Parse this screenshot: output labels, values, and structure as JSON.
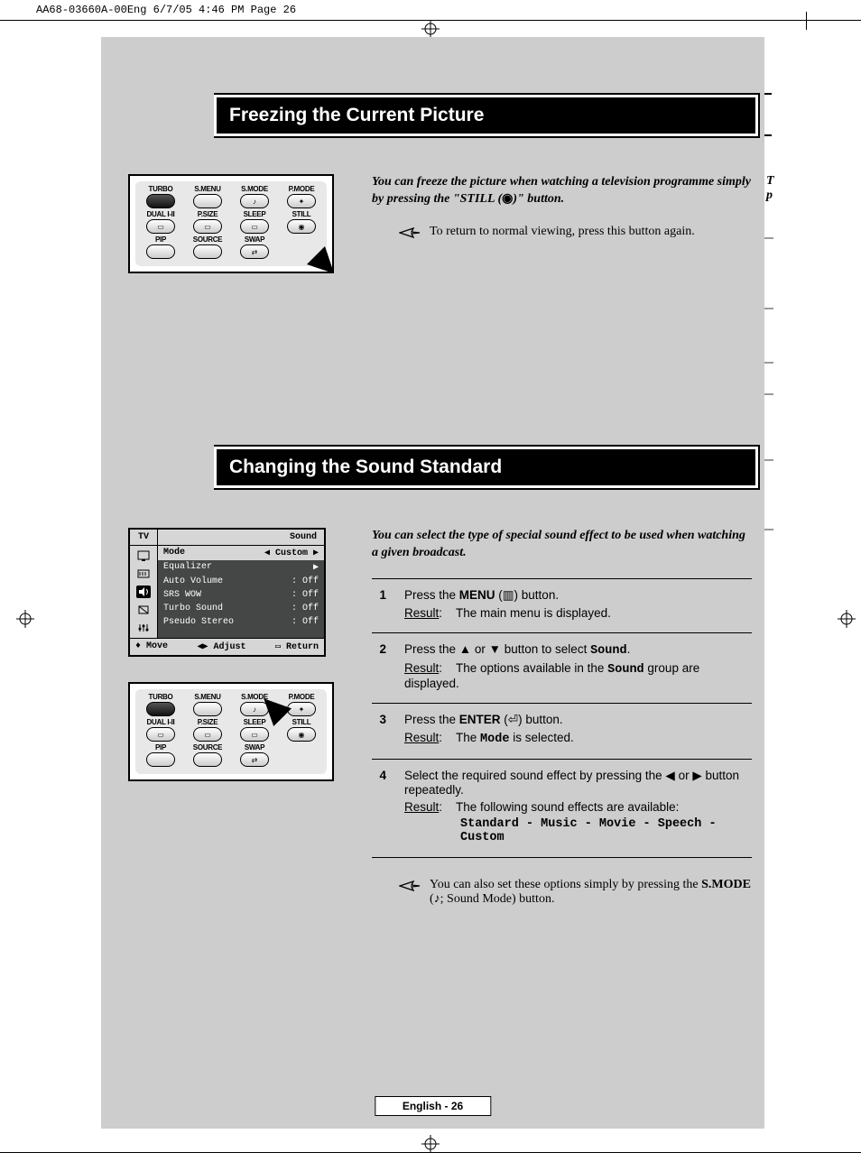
{
  "header": "AA68-03660A-00Eng  6/7/05  4:46 PM  Page 26",
  "section1": {
    "title": "Freezing the Current Picture",
    "intro_a": "You can freeze the picture when watching a television programme simply by pressing the \"STILL (",
    "intro_b": ")\" button.",
    "note": "To return to normal viewing, press this button again."
  },
  "section2": {
    "title": "Changing the Sound Standard",
    "intro": "You can select the type of special sound effect to be used when watching a given broadcast.",
    "steps": [
      {
        "num": "1",
        "line_a": "Press the ",
        "line_b": "MENU",
        "line_c": " (",
        "line_d": ") button.",
        "result_label": "Result",
        "result_text": "The main menu is displayed."
      },
      {
        "num": "2",
        "line_a": "Press the ▲ or ▼ button to select ",
        "line_b": "Sound",
        "line_c": ".",
        "result_label": "Result",
        "result_text_a": "The options available in the ",
        "result_text_b": "Sound",
        "result_text_c": " group are displayed."
      },
      {
        "num": "3",
        "line_a": "Press the ",
        "line_b": "ENTER",
        "line_c": " (",
        "line_d": ") button.",
        "result_label": "Result",
        "result_text_a": "The ",
        "result_text_b": "Mode",
        "result_text_c": " is selected."
      },
      {
        "num": "4",
        "line": "Select the required sound effect by pressing the ◀ or ▶ button repeatedly.",
        "result_label": "Result",
        "result_text": "The following sound effects are available:",
        "effects": "Standard - Music - Movie - Speech - Custom"
      }
    ],
    "tail_note_a": "You can also set these options simply by pressing the ",
    "tail_note_b": "S.MODE",
    "tail_note_c": " (",
    "tail_note_d": "; Sound Mode) button."
  },
  "remote": {
    "row1": [
      "TURBO",
      "S.MENU",
      "S.MODE",
      "P.MODE"
    ],
    "row2": [
      "DUAL I-II",
      "P.SIZE",
      "SLEEP",
      "STILL"
    ],
    "row3": [
      "PIP",
      "SOURCE",
      "SWAP",
      ""
    ]
  },
  "osd": {
    "tv": "TV",
    "title": "Sound",
    "rows": [
      {
        "k": "Mode",
        "v": "◀  Custom   ▶",
        "sel": true
      },
      {
        "k": "Equalizer",
        "v": "▶"
      },
      {
        "k": "Auto Volume",
        "v": ": Off"
      },
      {
        "k": "SRS WOW",
        "v": ": Off"
      },
      {
        "k": "Turbo Sound",
        "v": ": Off"
      },
      {
        "k": "Pseudo Stereo",
        "v": ": Off"
      }
    ],
    "foot": {
      "move": "Move",
      "adjust": "Adjust",
      "return": "Return"
    }
  },
  "footer": "English - 26",
  "right_edge": {
    "t": "T",
    "p": "p"
  }
}
